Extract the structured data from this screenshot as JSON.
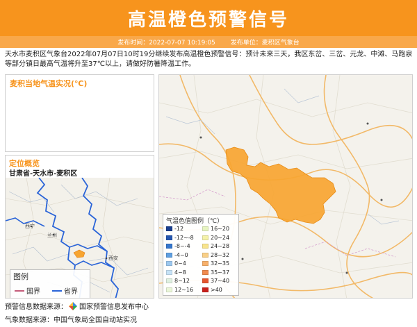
{
  "header": {
    "title": "高温橙色预警信号",
    "publish_time": "发布时间：2022-07-07 10:19:05",
    "publisher": "发布单位：麦积区气象台"
  },
  "description": "天水市麦积区气象台2022年07月07日10时19分继续发布高温橙色预警信号：预计未来三天，我区东岔、三岔、元龙、中滩、马跑泉等部分镇日最高气温将升至37℃以上，请做好防暑降温工作。",
  "temp_panel": {
    "title": "麦积当地气温实况(℃)"
  },
  "location_panel": {
    "title": "定位概览",
    "location": "甘肃省-天水市-麦积区",
    "map_labels": [
      "西宁",
      "兰州",
      "西安"
    ],
    "legend": {
      "title": "图例",
      "items": [
        {
          "label": "国界",
          "color": "#c45c7a"
        },
        {
          "label": "省界",
          "color": "#2a64d8"
        }
      ]
    }
  },
  "main_map": {
    "warning_color": "#f7a531",
    "legend_title": "气温色值图例（℃）",
    "legend_left": [
      {
        "label": "-12",
        "color": "#1a3f8f"
      },
      {
        "label": "-12~-8",
        "color": "#2456b0"
      },
      {
        "label": "-8~-4",
        "color": "#3576cc"
      },
      {
        "label": "-4~0",
        "color": "#5f9fe0"
      },
      {
        "label": "0~4",
        "color": "#9cc8ef"
      },
      {
        "label": "4~8",
        "color": "#c6e2f6"
      },
      {
        "label": "8~12",
        "color": "#dff0e0"
      },
      {
        "label": "12~16",
        "color": "#eaf6d8"
      }
    ],
    "legend_right": [
      {
        "label": "16~20",
        "color": "#e6f4c0"
      },
      {
        "label": "20~24",
        "color": "#f4f2a8"
      },
      {
        "label": "24~28",
        "color": "#f8e48c"
      },
      {
        "label": "28~32",
        "color": "#f9cf86"
      },
      {
        "label": "32~35",
        "color": "#f7b06a"
      },
      {
        "label": "35~37",
        "color": "#f08a4e"
      },
      {
        "label": "37~40",
        "color": "#e5562f"
      },
      {
        "label": ">40",
        "color": "#c9201b"
      }
    ]
  },
  "footer": {
    "warning_source_label": "预警信息数据来源：",
    "warning_source": "国家预警信息发布中心",
    "weather_source": "气象数据来源：中国气象局全国自动站实况"
  }
}
